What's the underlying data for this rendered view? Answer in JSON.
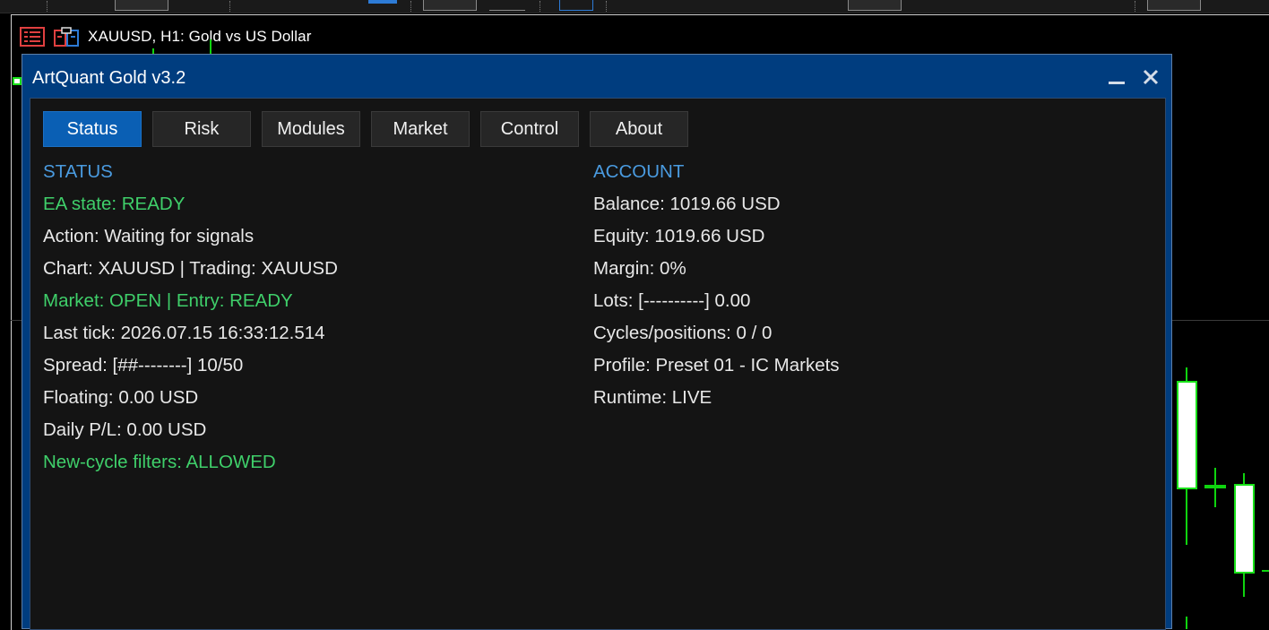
{
  "chart": {
    "title": "XAUUSD, H1:  Gold vs US Dollar",
    "colors": {
      "bull": "#19e119",
      "grid": "#3a3a3a",
      "background": "#000000"
    }
  },
  "panel": {
    "title": "ArtQuant Gold v3.2",
    "minimize_icon": "minimize-icon",
    "close_icon": "close-icon",
    "colors": {
      "titlebar": "#003d7f",
      "body": "#141414",
      "tab_active": "#0a5fb4",
      "heading": "#4a9be0",
      "ok": "#3fcf6a",
      "text": "#e8e8e8"
    },
    "tabs": [
      {
        "label": "Status",
        "active": true
      },
      {
        "label": "Risk",
        "active": false
      },
      {
        "label": "Modules",
        "active": false
      },
      {
        "label": "Market",
        "active": false
      },
      {
        "label": "Control",
        "active": false
      },
      {
        "label": "About",
        "active": false
      }
    ],
    "status": {
      "heading": "STATUS",
      "lines": [
        {
          "text": "EA state: READY",
          "style": "ok"
        },
        {
          "text": "Action: Waiting for signals",
          "style": "normal"
        },
        {
          "text": "Chart: XAUUSD | Trading: XAUUSD",
          "style": "normal"
        },
        {
          "text": "Market: OPEN | Entry: READY",
          "style": "ok"
        },
        {
          "text": "Last tick: 2026.07.15 16:33:12.514",
          "style": "normal"
        },
        {
          "text": "Spread: [##--------] 10/50",
          "style": "normal"
        },
        {
          "text": "Floating: 0.00 USD",
          "style": "normal"
        },
        {
          "text": "Daily P/L: 0.00 USD",
          "style": "normal"
        },
        {
          "text": "New-cycle filters: ALLOWED",
          "style": "ok"
        }
      ]
    },
    "account": {
      "heading": "ACCOUNT",
      "lines": [
        {
          "text": "Balance: 1019.66 USD",
          "style": "normal"
        },
        {
          "text": "Equity: 1019.66 USD",
          "style": "normal"
        },
        {
          "text": "Margin: 0%",
          "style": "normal"
        },
        {
          "text": "Lots: [----------] 0.00",
          "style": "normal"
        },
        {
          "text": "Cycles/positions: 0 / 0",
          "style": "normal"
        },
        {
          "text": "Profile: Preset 01 - IC Markets",
          "style": "normal"
        },
        {
          "text": "Runtime: LIVE",
          "style": "normal"
        }
      ]
    }
  }
}
